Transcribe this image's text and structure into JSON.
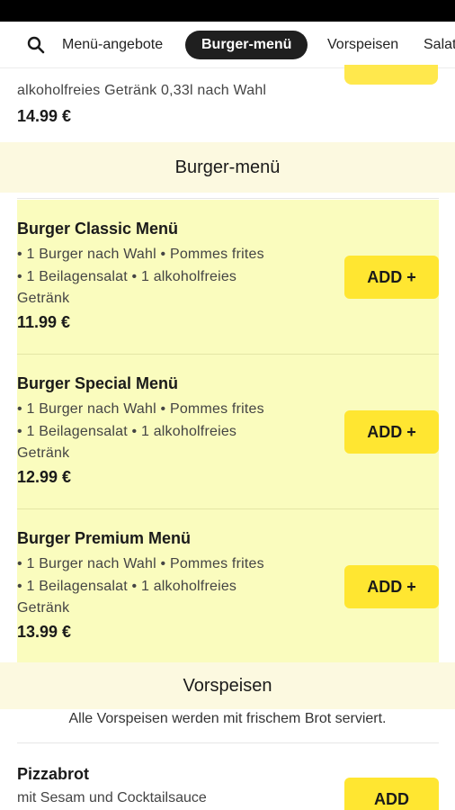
{
  "nav": {
    "tabs": [
      {
        "label": "Menü-angebote",
        "active": false
      },
      {
        "label": "Burger-menü",
        "active": true
      },
      {
        "label": "Vorspeisen",
        "active": false
      },
      {
        "label": "Salat",
        "active": false
      }
    ]
  },
  "previous_item": {
    "description": "alkoholfreies Getränk 0,33l nach Wahl",
    "price": "14.99 €"
  },
  "sections": [
    {
      "title": "Burger-menü",
      "items": [
        {
          "name": "Burger Classic Menü",
          "lines": [
            "• 1 Burger nach Wahl • Pommes frites",
            "• 1 Beilagensalat • 1 alkoholfreies",
            "Getränk"
          ],
          "price": "11.99 €",
          "add_label": "ADD +"
        },
        {
          "name": "Burger Special Menü",
          "lines": [
            "• 1 Burger nach Wahl • Pommes frites",
            "• 1 Beilagensalat • 1 alkoholfreies",
            "Getränk"
          ],
          "price": "12.99 €",
          "add_label": "ADD +"
        },
        {
          "name": "Burger Premium Menü",
          "lines": [
            "• 1 Burger nach Wahl • Pommes frites",
            "• 1 Beilagensalat • 1 alkoholfreies",
            "Getränk"
          ],
          "price": "13.99 €",
          "add_label": "ADD +"
        }
      ]
    },
    {
      "title": "Vorspeisen",
      "note": "Alle Vorspeisen werden mit frischem Brot serviert.",
      "items": [
        {
          "name": "Pizzabrot",
          "lines": [
            "mit Sesam und Cocktailsauce"
          ],
          "add_label": "ADD"
        }
      ]
    }
  ],
  "colors": {
    "highlight_bg": "#fafcbe",
    "section_bg": "#fcf9e0",
    "button": "#ffe631",
    "active_tab": "#1f1f1f"
  },
  "icons": {
    "search": "search-icon"
  }
}
